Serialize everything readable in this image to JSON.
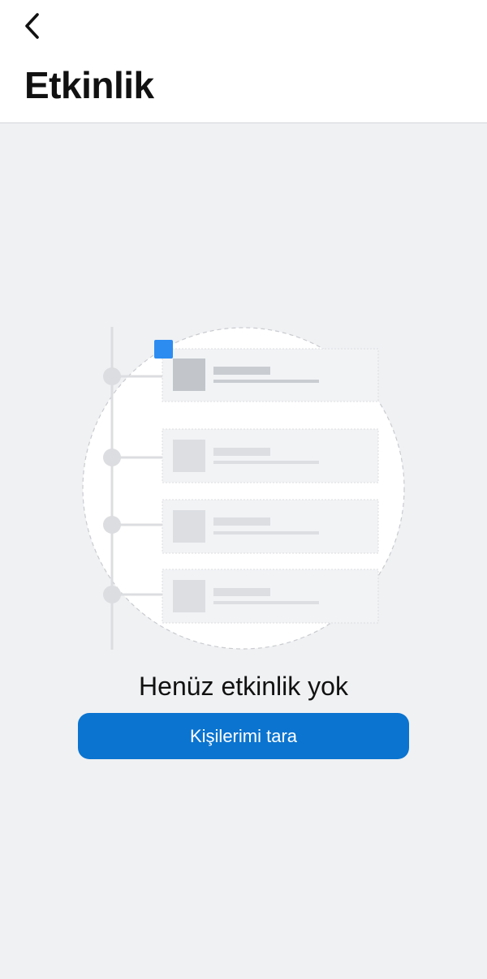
{
  "header": {
    "back_icon": "chevron-left-icon",
    "title": "Etkinlik"
  },
  "empty_state": {
    "illustration": "activity-timeline-illustration",
    "title": "Henüz etkinlik yok",
    "button_label": "Kişilerimi tara"
  },
  "colors": {
    "background": "#f0f1f3",
    "header_background": "#ffffff",
    "button": "#0b74d0",
    "highlight_square": "#2d8cf0",
    "text": "#111111"
  }
}
